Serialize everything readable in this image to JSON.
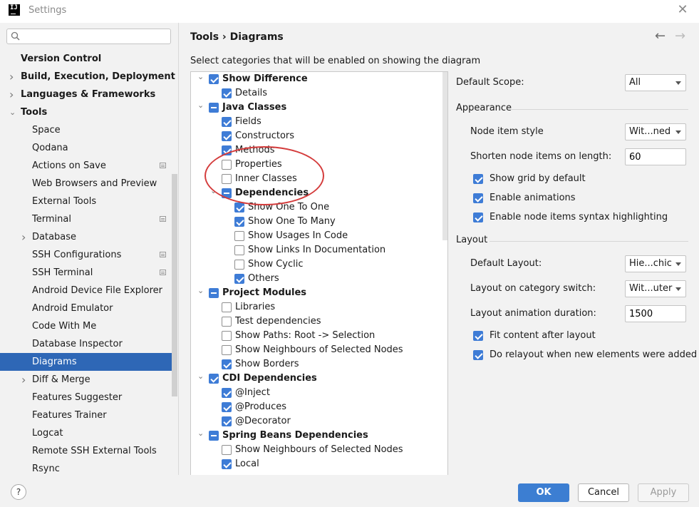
{
  "window": {
    "title": "Settings",
    "app_icon_text": "IJ"
  },
  "search": {
    "placeholder": "",
    "value": ""
  },
  "sidebar": {
    "items": [
      {
        "label": "Version Control",
        "bold": true,
        "indent": 0,
        "arrow": ""
      },
      {
        "label": "Build, Execution, Deployment",
        "bold": true,
        "indent": 0,
        "arrow": "collapsed"
      },
      {
        "label": "Languages & Frameworks",
        "bold": true,
        "indent": 0,
        "arrow": "collapsed"
      },
      {
        "label": "Tools",
        "bold": true,
        "indent": 0,
        "arrow": "expanded"
      },
      {
        "label": "Space",
        "indent": 1,
        "arrow": ""
      },
      {
        "label": "Qodana",
        "indent": 1,
        "arrow": ""
      },
      {
        "label": "Actions on Save",
        "indent": 1,
        "arrow": "",
        "badge": true
      },
      {
        "label": "Web Browsers and Preview",
        "indent": 1,
        "arrow": ""
      },
      {
        "label": "External Tools",
        "indent": 1,
        "arrow": ""
      },
      {
        "label": "Terminal",
        "indent": 1,
        "arrow": "",
        "badge": true
      },
      {
        "label": "Database",
        "indent": 1,
        "arrow": "collapsed"
      },
      {
        "label": "SSH Configurations",
        "indent": 1,
        "arrow": "",
        "badge": true
      },
      {
        "label": "SSH Terminal",
        "indent": 1,
        "arrow": "",
        "badge": true
      },
      {
        "label": "Android Device File Explorer",
        "indent": 1,
        "arrow": ""
      },
      {
        "label": "Android Emulator",
        "indent": 1,
        "arrow": ""
      },
      {
        "label": "Code With Me",
        "indent": 1,
        "arrow": ""
      },
      {
        "label": "Database Inspector",
        "indent": 1,
        "arrow": ""
      },
      {
        "label": "Diagrams",
        "indent": 1,
        "arrow": "",
        "selected": true
      },
      {
        "label": "Diff & Merge",
        "indent": 1,
        "arrow": "collapsed"
      },
      {
        "label": "Features Suggester",
        "indent": 1,
        "arrow": ""
      },
      {
        "label": "Features Trainer",
        "indent": 1,
        "arrow": ""
      },
      {
        "label": "Logcat",
        "indent": 1,
        "arrow": ""
      },
      {
        "label": "Remote SSH External Tools",
        "indent": 1,
        "arrow": ""
      },
      {
        "label": "Rsync",
        "indent": 1,
        "arrow": ""
      }
    ]
  },
  "header": {
    "breadcrumb": "Tools  ›  Diagrams",
    "back_icon": "←",
    "forward_icon": "→"
  },
  "instruction": "Select categories that will be enabled on showing the diagram",
  "tree": [
    {
      "label": "Show Difference",
      "level": 0,
      "state": "on",
      "expand": "expanded",
      "bold": true
    },
    {
      "label": "Details",
      "level": 1,
      "state": "on"
    },
    {
      "label": "Java Classes",
      "level": 0,
      "state": "part",
      "expand": "expanded",
      "bold": true
    },
    {
      "label": "Fields",
      "level": 1,
      "state": "on"
    },
    {
      "label": "Constructors",
      "level": 1,
      "state": "on"
    },
    {
      "label": "Methods",
      "level": 1,
      "state": "on"
    },
    {
      "label": "Properties",
      "level": 1,
      "state": "off"
    },
    {
      "label": "Inner Classes",
      "level": 1,
      "state": "off"
    },
    {
      "label": "Dependencies",
      "level": 1,
      "state": "part",
      "expand": "expanded",
      "bold": true
    },
    {
      "label": "Show One To One",
      "level": 2,
      "state": "on"
    },
    {
      "label": "Show One To Many",
      "level": 2,
      "state": "on"
    },
    {
      "label": "Show Usages In Code",
      "level": 2,
      "state": "off"
    },
    {
      "label": "Show Links In Documentation",
      "level": 2,
      "state": "off"
    },
    {
      "label": "Show Cyclic",
      "level": 2,
      "state": "off"
    },
    {
      "label": "Others",
      "level": 2,
      "state": "on"
    },
    {
      "label": "Project Modules",
      "level": 0,
      "state": "part",
      "expand": "expanded",
      "bold": true
    },
    {
      "label": "Libraries",
      "level": 1,
      "state": "off"
    },
    {
      "label": "Test dependencies",
      "level": 1,
      "state": "off"
    },
    {
      "label": "Show Paths: Root -> Selection",
      "level": 1,
      "state": "off"
    },
    {
      "label": "Show Neighbours of Selected Nodes",
      "level": 1,
      "state": "off"
    },
    {
      "label": "Show Borders",
      "level": 1,
      "state": "on"
    },
    {
      "label": "CDI Dependencies",
      "level": 0,
      "state": "on",
      "expand": "expanded",
      "bold": true
    },
    {
      "label": "@Inject",
      "level": 1,
      "state": "on"
    },
    {
      "label": "@Produces",
      "level": 1,
      "state": "on"
    },
    {
      "label": "@Decorator",
      "level": 1,
      "state": "on"
    },
    {
      "label": "Spring Beans Dependencies",
      "level": 0,
      "state": "part",
      "expand": "expanded",
      "bold": true
    },
    {
      "label": "Show Neighbours of Selected Nodes",
      "level": 1,
      "state": "off"
    },
    {
      "label": "Local",
      "level": 1,
      "state": "on"
    }
  ],
  "settings": {
    "default_scope_label": "Default Scope:",
    "default_scope_value": "All",
    "appearance_header": "Appearance",
    "node_item_style_label": "Node item style",
    "node_item_style_value": "Wit...ned",
    "shorten_label": "Shorten node items on length:",
    "shorten_value": "60",
    "show_grid": {
      "label": "Show grid by default",
      "checked": true
    },
    "enable_animations": {
      "label": "Enable animations",
      "checked": true
    },
    "syntax_highlighting": {
      "label": "Enable node items syntax highlighting",
      "checked": true
    },
    "layout_header": "Layout",
    "default_layout_label": "Default Layout:",
    "default_layout_value": "Hie...chic",
    "category_switch_label": "Layout on category switch:",
    "category_switch_value": "Wit...uter",
    "animation_duration_label": "Layout animation duration:",
    "animation_duration_value": "1500",
    "fit_content": {
      "label": "Fit content after layout",
      "checked": true
    },
    "do_relayout": {
      "label": "Do relayout when new elements were added",
      "checked": true
    }
  },
  "footer": {
    "help": "?",
    "ok": "OK",
    "cancel": "Cancel",
    "apply": "Apply"
  },
  "colors": {
    "accent": "#3c7ed2",
    "selection": "#2e67b6",
    "annotation": "#d43c3c"
  }
}
